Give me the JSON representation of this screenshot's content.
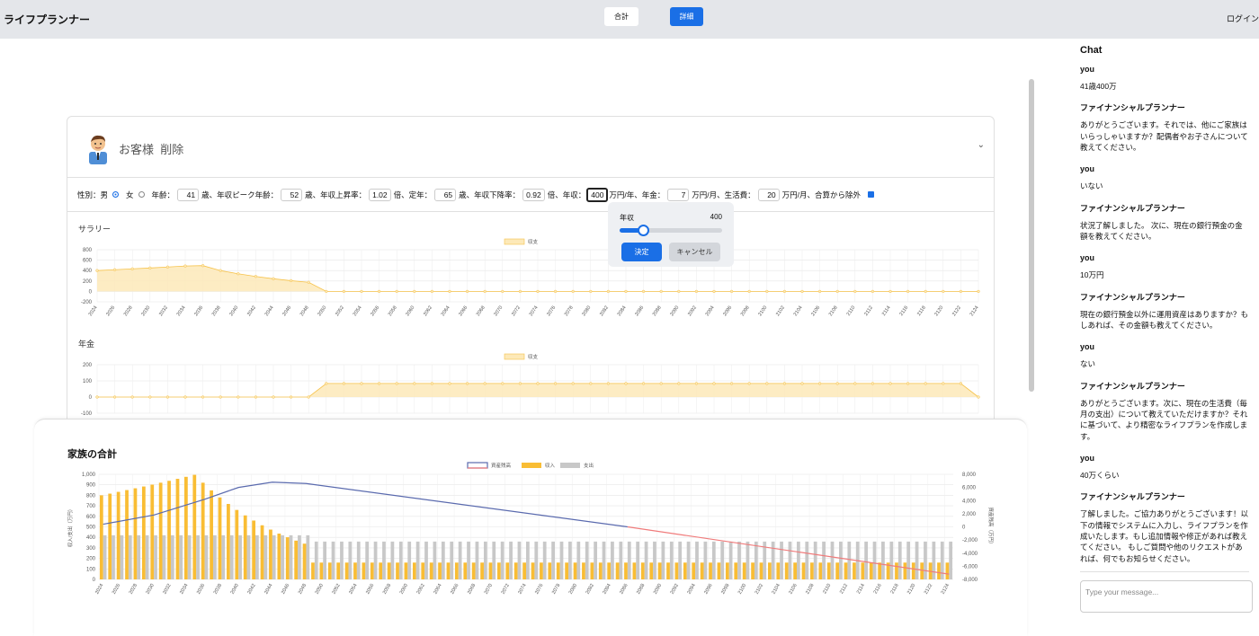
{
  "header": {
    "brand": "ライフプランナー",
    "tab_total": "合計",
    "tab_detail": "詳細",
    "login": "ログイン"
  },
  "customer": {
    "name": "お客様",
    "delete": "削除"
  },
  "params": {
    "gender_label": "性別：",
    "male": "男",
    "female": "女",
    "age_label": "年齢：",
    "age": "41",
    "age_unit_peak": "歳、年収ピーク年齢：",
    "peak_age": "52",
    "rise_label": "歳、年収上昇率：",
    "rise_rate": "1.02",
    "retire_label": "倍、定年：",
    "retire_age": "65",
    "decline_label": "歳、年収下降率：",
    "decline_rate": "0.92",
    "income_label": "倍、年収：",
    "income": "400",
    "pension_label": "万円/年、年金：",
    "pension": "7",
    "living_label": "万円/月、生活費：",
    "living": "20",
    "exclude_label": "万円/月、合算から除外"
  },
  "popover": {
    "title": "年収",
    "value": "400",
    "slider_fraction": 0.23,
    "ok": "決定",
    "cancel": "キャンセル"
  },
  "salary_label": "サラリー",
  "pension_label": "年金",
  "family_title": "家族の合計",
  "colors": {
    "accent": "#1a6fe6",
    "income_fill": "#fde9b8",
    "income_line": "#f6c24a",
    "asset_line_pos": "#5a6aae",
    "asset_line_neg": "#f07b7b",
    "expense_bar": "#c8c8c8",
    "income_bar": "#f9bd34"
  },
  "chart_data": [
    {
      "type": "area",
      "legend": [
        "収支"
      ],
      "ylim": [
        -200,
        800
      ],
      "yticks": [
        "800",
        "600",
        "400",
        "200",
        "0",
        "-200"
      ],
      "x": [
        2024,
        2026,
        2028,
        2030,
        2032,
        2034,
        2036,
        2038,
        2040,
        2042,
        2044,
        2046,
        2048,
        2050,
        2052,
        2054,
        2056,
        2058,
        2060,
        2062,
        2064,
        2066,
        2068,
        2070,
        2072,
        2074,
        2076,
        2078,
        2080,
        2082,
        2084,
        2086,
        2088,
        2090,
        2092,
        2094,
        2096,
        2098,
        2100,
        2102,
        2104,
        2106,
        2108,
        2110,
        2112,
        2114,
        2116,
        2118,
        2120,
        2122,
        2124
      ],
      "series": [
        {
          "name": "収支",
          "values": [
            400,
            416,
            433,
            450,
            468,
            487,
            495,
            400,
            339,
            287,
            243,
            206,
            175,
            0,
            0,
            0,
            0,
            0,
            0,
            0,
            0,
            0,
            0,
            0,
            0,
            0,
            0,
            0,
            0,
            0,
            0,
            0,
            0,
            0,
            0,
            0,
            0,
            0,
            0,
            0,
            0,
            0,
            0,
            0,
            0,
            0,
            0,
            0,
            0,
            0,
            0
          ]
        }
      ]
    },
    {
      "type": "area",
      "legend": [
        "収支"
      ],
      "ylim": [
        -100,
        200
      ],
      "yticks": [
        "200",
        "100",
        "0",
        "-100"
      ],
      "x": [
        2024,
        2026,
        2028,
        2030,
        2032,
        2034,
        2036,
        2038,
        2040,
        2042,
        2044,
        2046,
        2048,
        2050,
        2052,
        2054,
        2056,
        2058,
        2060,
        2062,
        2064,
        2066,
        2068,
        2070,
        2072,
        2074,
        2076,
        2078,
        2080,
        2082,
        2084,
        2086,
        2088,
        2090,
        2092,
        2094,
        2096,
        2098,
        2100,
        2102,
        2104,
        2106,
        2108,
        2110,
        2112,
        2114,
        2116,
        2118,
        2120,
        2122,
        2124
      ],
      "series": [
        {
          "name": "収支",
          "values": [
            0,
            0,
            0,
            0,
            0,
            0,
            0,
            0,
            0,
            0,
            0,
            0,
            0,
            84,
            84,
            84,
            84,
            84,
            84,
            84,
            84,
            84,
            84,
            84,
            84,
            84,
            84,
            84,
            84,
            84,
            84,
            84,
            84,
            84,
            84,
            84,
            84,
            84,
            84,
            84,
            84,
            84,
            84,
            84,
            84,
            84,
            84,
            84,
            84,
            84,
            0
          ]
        }
      ]
    },
    {
      "type": "bar",
      "legend": [
        "資産残高",
        "収入",
        "支出"
      ],
      "ylabel": "収入/支出（万円）",
      "y2label": "資産残高（万円）",
      "ylim": [
        0,
        1000
      ],
      "y2lim": [
        -8000,
        8000
      ],
      "yticks": [
        "1,000",
        "900",
        "800",
        "700",
        "600",
        "500",
        "400",
        "300",
        "200",
        "100",
        "0"
      ],
      "y2ticks": [
        "8,000",
        "6,000",
        "4,000",
        "2,000",
        "0",
        "-2,000",
        "-4,000",
        "-6,000",
        "-8,000"
      ],
      "x_start": 2024,
      "x_end": 2124,
      "income_first_years": [
        800,
        816,
        833,
        850,
        867,
        884,
        902,
        920,
        938,
        957,
        976,
        995,
        920,
        847,
        780,
        718,
        661,
        609,
        560,
        515,
        474,
        436,
        401,
        369,
        340
      ],
      "income_after_retire": 160,
      "expense_before_retire": 420,
      "expense_after_retire": 360,
      "asset_points": [
        [
          2024,
          400
        ],
        [
          2030,
          1800
        ],
        [
          2036,
          4200
        ],
        [
          2040,
          6000
        ],
        [
          2044,
          6800
        ],
        [
          2048,
          6600
        ],
        [
          2086,
          0
        ],
        [
          2124,
          -7200
        ]
      ]
    }
  ],
  "chat": {
    "title": "Chat",
    "messages": [
      {
        "who": "you",
        "text": "41歳400万"
      },
      {
        "who": "ファイナンシャルプランナー",
        "text": "ありがとうございます。それでは、他にご家族はいらっしゃいますか？配偶者やお子さんについて教えてください。"
      },
      {
        "who": "you",
        "text": "いない"
      },
      {
        "who": "ファイナンシャルプランナー",
        "text": "状況了解しました。 次に、現在の銀行預金の金額を教えてください。"
      },
      {
        "who": "you",
        "text": "10万円"
      },
      {
        "who": "ファイナンシャルプランナー",
        "text": "現在の銀行預金以外に運用資産はありますか？もしあれば、その金額も教えてください。"
      },
      {
        "who": "you",
        "text": "ない"
      },
      {
        "who": "ファイナンシャルプランナー",
        "text": "ありがとうございます。次に、現在の生活費（毎月の支出）について教えていただけますか？それに基づいて、より精密なライフプランを作成します。"
      },
      {
        "who": "you",
        "text": "40万くらい"
      },
      {
        "who": "ファイナンシャルプランナー",
        "text": "了解しました。ご協力ありがとうございます！以下の情報でシステムに入力し、ライフプランを作成いたします。もし追加情報や修正があれば教えてください。 もしご質問や他のリクエストがあれば、何でもお知らせください。"
      }
    ],
    "input_placeholder": "Type your message..."
  }
}
